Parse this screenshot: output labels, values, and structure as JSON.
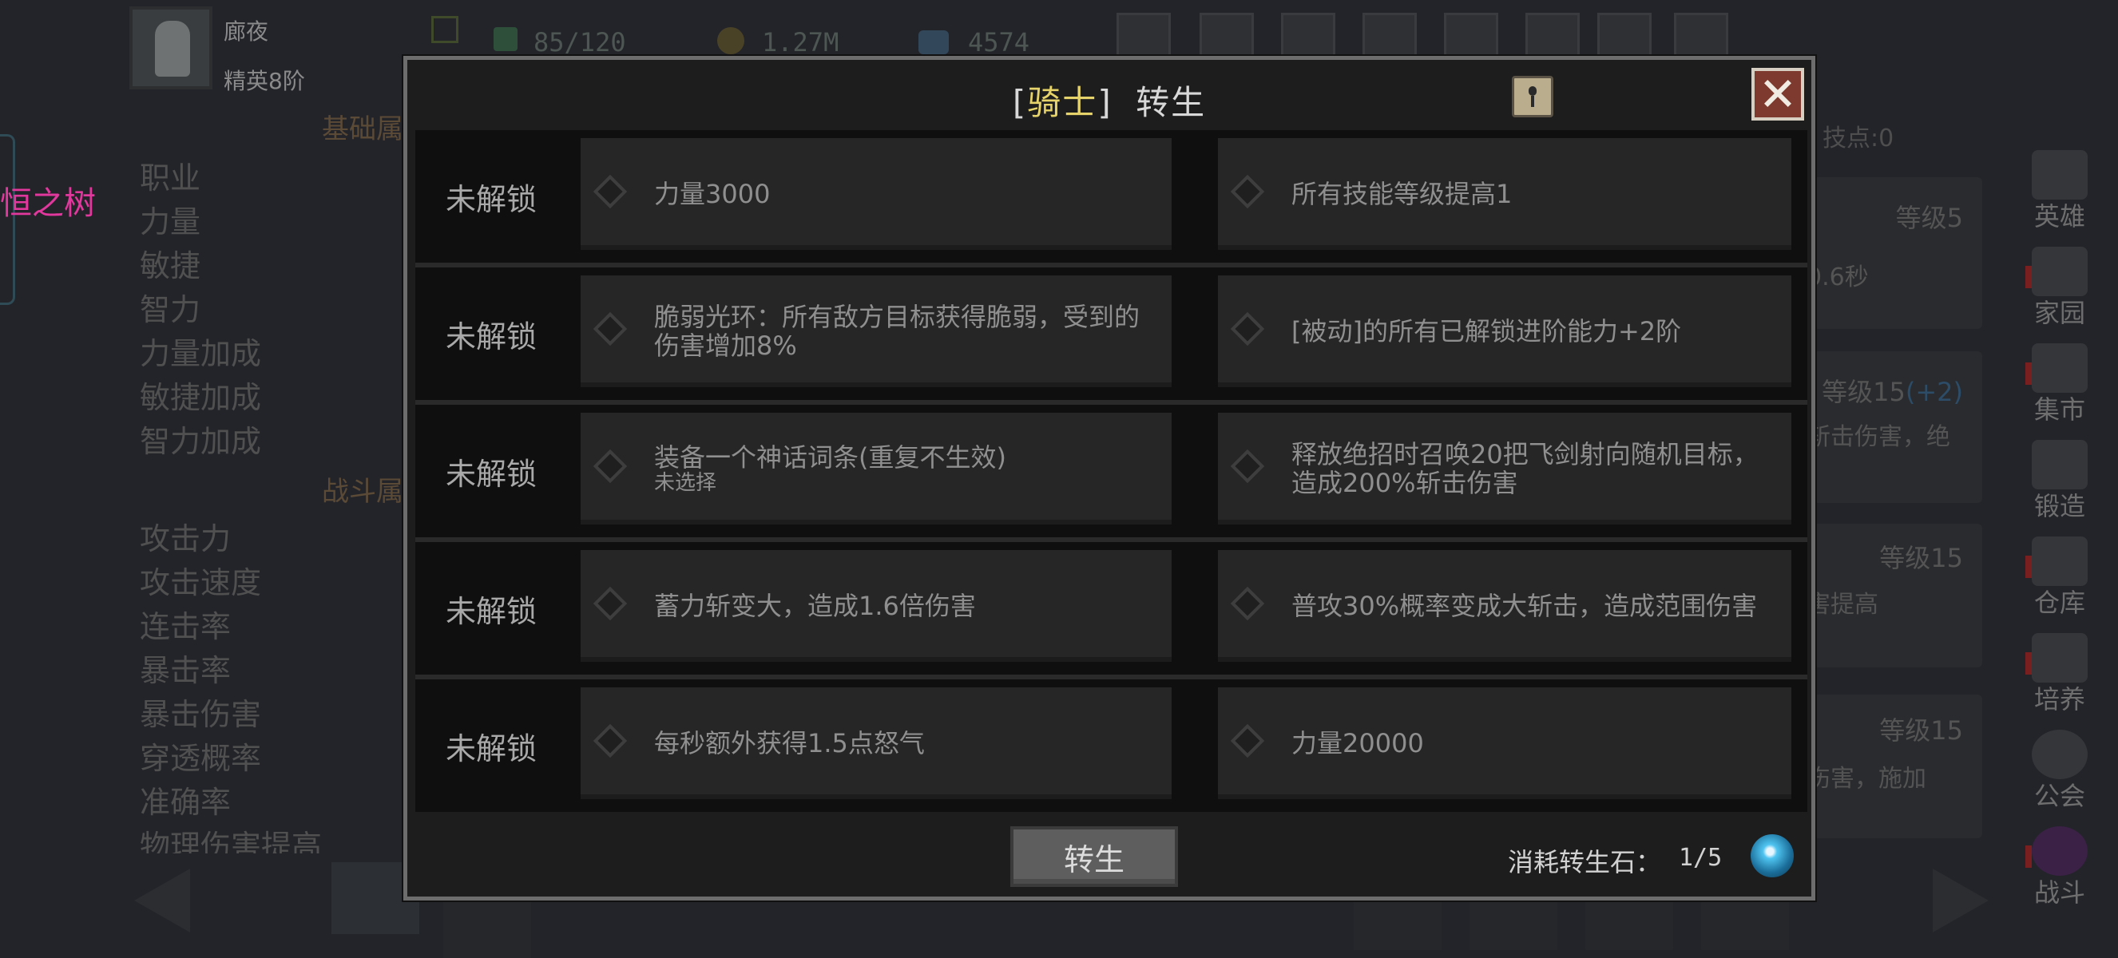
{
  "topbar": {
    "player_name": "廊夜",
    "player_rank": "精英8阶",
    "stamina": "85/120",
    "gold": "1.27M",
    "gems": "4574"
  },
  "left_panel": {
    "tree_label": "恒之树",
    "section_basic": "基础属",
    "section_combat": "战斗属",
    "stats_basic": [
      "职业",
      "力量",
      "敏捷",
      "智力",
      "力量加成",
      "敏捷加成",
      "智力加成"
    ],
    "stats_combat": [
      "攻击力",
      "攻击速度",
      "连击率",
      "暴击率",
      "暴击伤害",
      "穿透概率",
      "准确率",
      "物理伤害提高"
    ]
  },
  "right_panel": {
    "points": "技点:0",
    "cards": [
      {
        "level": "等级5",
        "text": "0.6秒"
      },
      {
        "level": "等级15",
        "bonus": "(+2)",
        "text": "斩击伤害，绝"
      },
      {
        "level": "等级15",
        "text": "害提高"
      },
      {
        "level": "等级15",
        "text": "伤害，施加"
      }
    ]
  },
  "right_nav": [
    "英雄",
    "家园",
    "集市",
    "锻造",
    "仓库",
    "培养",
    "公会",
    "战斗"
  ],
  "modal": {
    "title_bracket_open": "[",
    "title_class": "骑士",
    "title_bracket_close": "]",
    "title_rest": "转生",
    "rows": [
      {
        "status": "未解锁",
        "left": "力量3000",
        "left_sub": "",
        "right": "所有技能等级提高1"
      },
      {
        "status": "未解锁",
        "left": "脆弱光环：所有敌方目标获得脆弱，受到的伤害增加8%",
        "left_sub": "",
        "right": "[被动]的所有已解锁进阶能力+2阶"
      },
      {
        "status": "未解锁",
        "left": "装备一个神话词条(重复不生效)",
        "left_sub": "未选择",
        "right": "释放绝招时召唤20把飞剑射向随机目标，造成200%斩击伤害"
      },
      {
        "status": "未解锁",
        "left": "蓄力斩变大，造成1.6倍伤害",
        "left_sub": "",
        "right": "普攻30%概率变成大斩击，造成范围伤害"
      },
      {
        "status": "未解锁",
        "left": "每秒额外获得1.5点怒气",
        "left_sub": "",
        "right": "力量20000"
      }
    ],
    "rebirth_button": "转生",
    "cost_label": "消耗转生石：",
    "cost_value": "1/5"
  },
  "colors": {
    "accent_yellow": "#e6d36a",
    "tree_pink": "#e0389c",
    "close_red": "#7e3a2e"
  }
}
